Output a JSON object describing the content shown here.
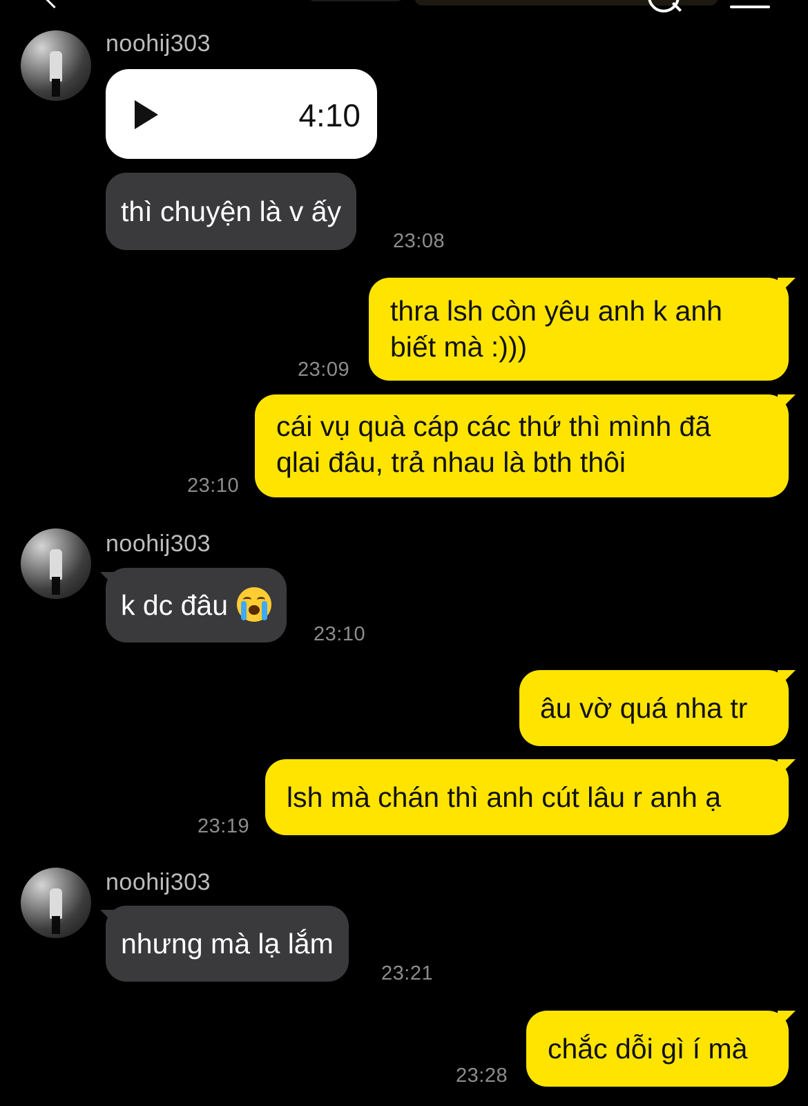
{
  "header": {
    "back_icon": "chevron-left-icon",
    "search_icon": "search-icon",
    "menu_icon": "menu-icon"
  },
  "messages": [
    {
      "sender": "noohij303",
      "voice_duration": "4:10",
      "text": "thì chuyện là v ấy",
      "time": "23:08"
    },
    {
      "text_line1": "thra lsh còn yêu anh k anh",
      "text_line2": "biết mà :)))",
      "time": "23:09"
    },
    {
      "text_line1": "cái vụ quà cáp các thứ thì mình đã",
      "text_line2": "qlai đâu, trả nhau là bth thôi",
      "time": "23:10"
    },
    {
      "sender": "noohij303",
      "text": "k dc đâu",
      "emoji": "crying-face",
      "time": "23:10"
    },
    {
      "text": "âu vờ quá nha tr"
    },
    {
      "text": "lsh mà chán thì anh cút lâu r anh ạ",
      "time": "23:19"
    },
    {
      "sender": "noohij303",
      "text": "nhưng mà lạ lắm",
      "time": "23:21"
    },
    {
      "text": "chắc dỗi gì í mà",
      "time": "23:28"
    }
  ],
  "colors": {
    "background": "#000000",
    "incoming_bubble": "#3a3a3d",
    "outgoing_bubble": "#ffe400",
    "timestamp": "#8d8d8d"
  }
}
